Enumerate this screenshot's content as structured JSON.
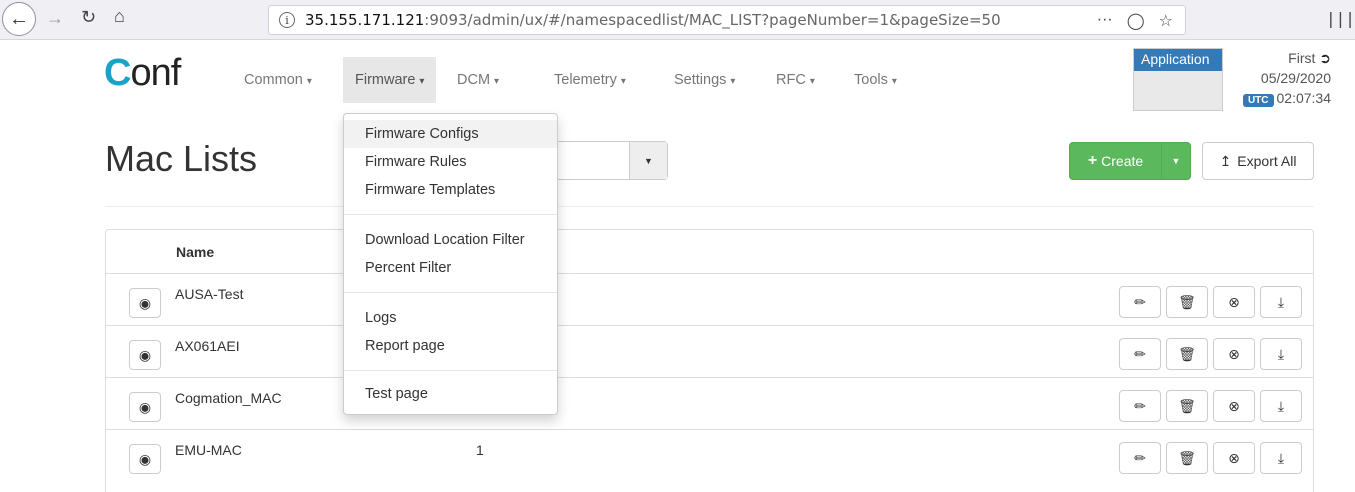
{
  "browser": {
    "url_prefix": "35.155.171.121",
    "url_rest": ":9093/admin/ux/#/namespacedlist/MAC_LIST?pageNumber=1&pageSize=50",
    "more_label": "···"
  },
  "navbar": {
    "logo_c": "C",
    "logo_text": "onf",
    "items": [
      {
        "label": "Common"
      },
      {
        "label": "Firmware"
      },
      {
        "label": "DCM"
      },
      {
        "label": "Telemetry"
      },
      {
        "label": "Settings"
      },
      {
        "label": "RFC"
      },
      {
        "label": "Tools"
      }
    ],
    "application_label": "Application",
    "user_name": "First",
    "date": "05/29/2020",
    "utc_label": "UTC",
    "time": "02:07:34"
  },
  "page": {
    "title": "Mac Lists",
    "create_label": "Create",
    "export_label": "Export All"
  },
  "table": {
    "header_name": "Name",
    "rows": [
      {
        "name": "AUSA-Test",
        "count": ""
      },
      {
        "name": "AX061AEI",
        "count": ""
      },
      {
        "name": "Cogmation_MAC",
        "count": ""
      },
      {
        "name": "EMU-MAC",
        "count": "1"
      }
    ]
  },
  "firmware_menu": {
    "items": [
      "Firmware Configs",
      "Firmware Rules",
      "Firmware Templates",
      "Download Location Filter",
      "Percent Filter",
      "Logs",
      "Report page",
      "Test page"
    ]
  },
  "colors": {
    "accent": "#337ab7",
    "success": "#5cb85c",
    "logo": "#1aa3c8"
  }
}
